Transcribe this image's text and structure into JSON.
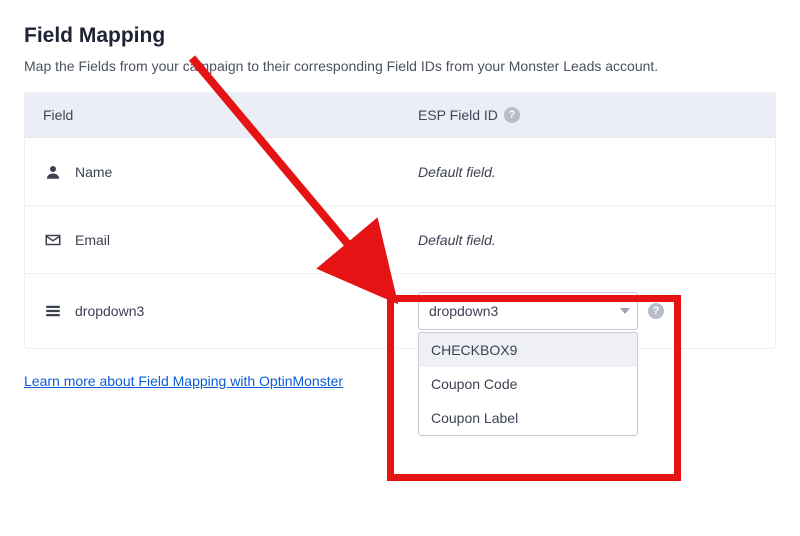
{
  "heading": "Field Mapping",
  "subtitle": "Map the Fields from your campaign to their corresponding Field IDs from your Monster Leads account.",
  "columns": {
    "field": "Field",
    "esp": "ESP Field ID"
  },
  "rows": {
    "name": {
      "label": "Name",
      "value": "Default field."
    },
    "email": {
      "label": "Email",
      "value": "Default field."
    },
    "dropdown": {
      "label": "dropdown3",
      "input_value": "dropdown3"
    }
  },
  "dropdown_options": {
    "0": "CHECKBOX9",
    "1": "Coupon Code",
    "2": "Coupon Label"
  },
  "help_glyph": "?",
  "learn_more": "Learn more about Field Mapping with OptinMonster "
}
